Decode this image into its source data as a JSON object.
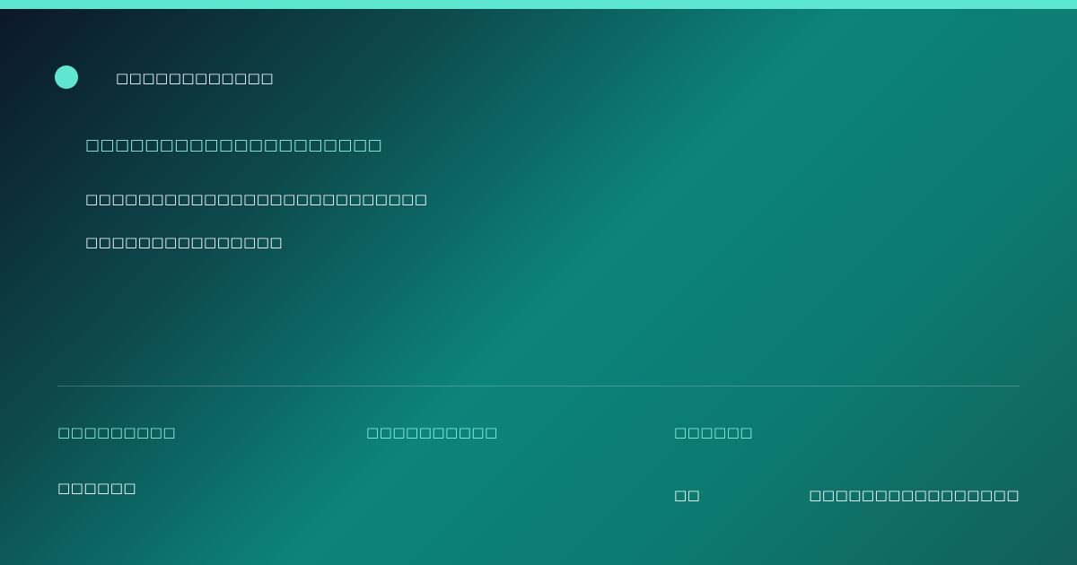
{
  "colors": {
    "accent": "#5de7d3",
    "accent_text": "#8ef0e0",
    "text": "#ffffff",
    "background_start": "#0c1628",
    "background_mid": "#0c847a",
    "background_end": "#135e5a"
  },
  "brand": {
    "name": "□□□□□□□□□□□□",
    "logo_icon": "circle-logo-icon"
  },
  "hero": {
    "headline": "□□□□□□□□□□□□□□□□□□□□",
    "description_lines": [
      "□□□□□□□□□□□□□□□□□□□□□□□□□□",
      "□□□□□□□□□□□□□□□"
    ]
  },
  "details": {
    "columns": [
      {
        "label": "□□□□□□□□□",
        "value": "□□□□□□"
      },
      {
        "label": "□□□□□□□□□□"
      },
      {
        "label": "□□□□□□",
        "value_primary": "□□",
        "value_secondary": "□□□□□□□□□□□□□□□□"
      }
    ]
  }
}
